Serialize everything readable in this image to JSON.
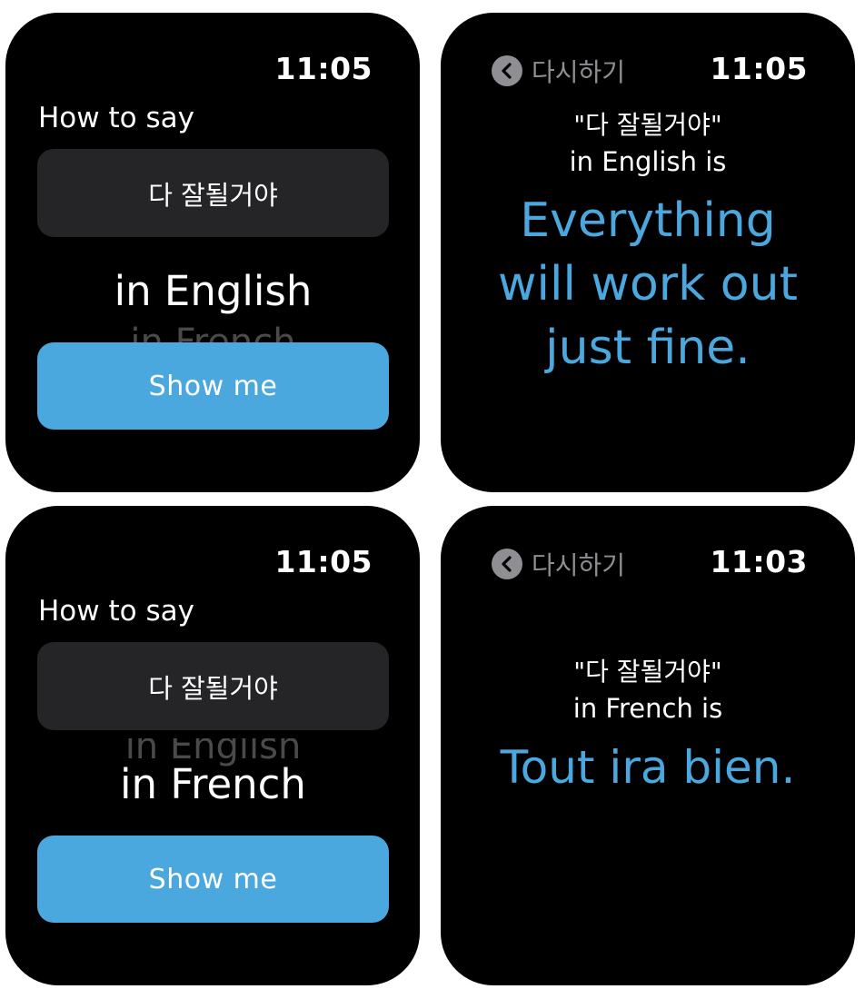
{
  "colors": {
    "accent": "#4aa8de",
    "screen_background": "#000000",
    "phrase_box": "#252527",
    "back_gray": "#8f8f93"
  },
  "screens": [
    {
      "time": "11:05",
      "prompt": "How to say",
      "phrase": "다 잘될거야",
      "picker_selected": "in English",
      "picker_next": "in French",
      "button": "Show me"
    },
    {
      "back_icon": "chevron-left-icon",
      "back_label": "다시하기",
      "time": "11:05",
      "quote": "\"다 잘될거야\"",
      "language_line": "in English is",
      "translation_lines": [
        "Everything",
        "will work out",
        "just fine."
      ]
    },
    {
      "time": "11:05",
      "prompt": "How to say",
      "phrase": "다 잘될거야",
      "picker_previous": "in English",
      "picker_selected": "in French",
      "button": "Show me"
    },
    {
      "back_icon": "chevron-left-icon",
      "back_label": "다시하기",
      "time": "11:03",
      "quote": "\"다 잘될거야\"",
      "language_line": "in French is",
      "translation": "Tout ira bien."
    }
  ]
}
